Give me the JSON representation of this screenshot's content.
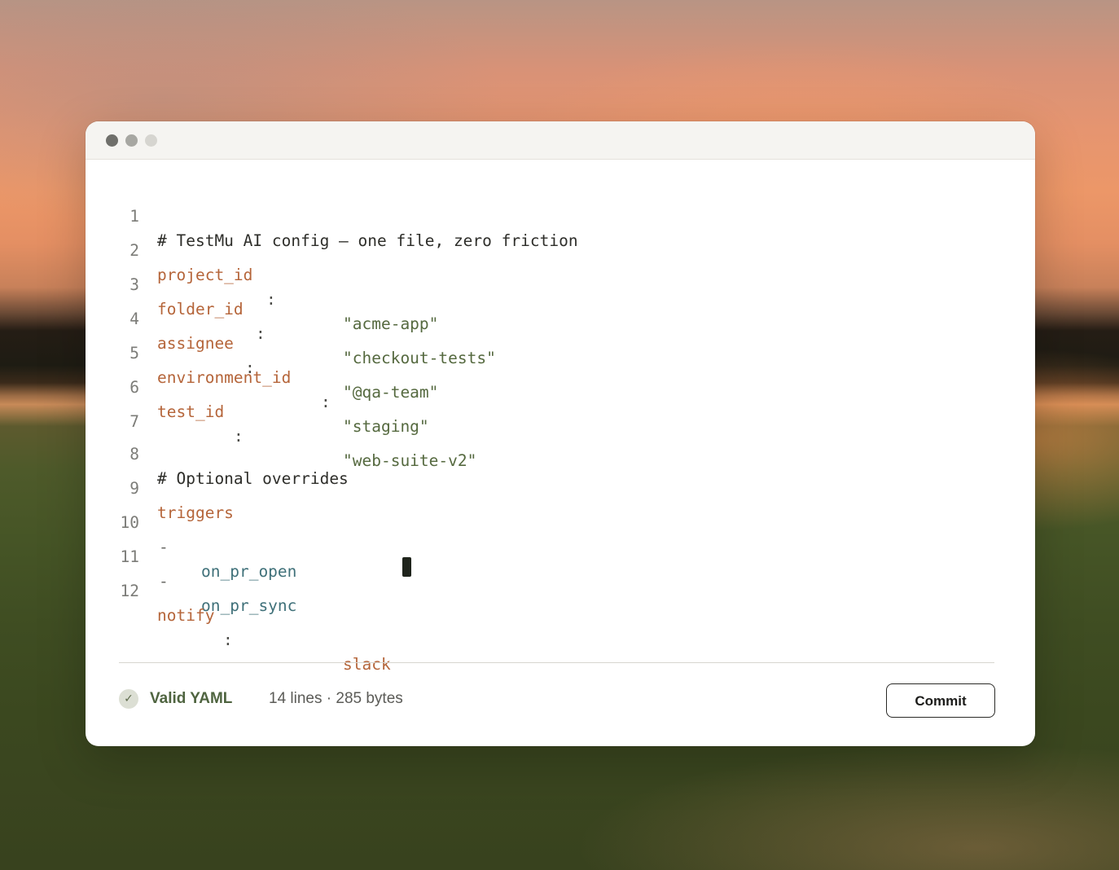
{
  "editor": {
    "lines": [
      {
        "num": "1",
        "comment": "# TestMu AI config — one file, zero friction"
      },
      {
        "num": "2",
        "key": "project_id",
        "colon": ":",
        "value": "\"acme-app\""
      },
      {
        "num": "3",
        "key": "folder_id",
        "colon": ":",
        "value": "\"checkout-tests\""
      },
      {
        "num": "4",
        "key": "assignee",
        "colon": ":",
        "value": "\"@qa-team\""
      },
      {
        "num": "5",
        "key": "environment_id",
        "colon": ":",
        "value": "\"staging\""
      },
      {
        "num": "6",
        "key": "test_id",
        "colon": ":",
        "value": "\"web-suite-v2\""
      },
      {
        "num": "7"
      },
      {
        "num": "8",
        "comment": "# Optional overrides"
      },
      {
        "num": "9",
        "key": "triggers"
      },
      {
        "num": "10",
        "dash": "-",
        "item": "on_pr_open"
      },
      {
        "num": "11",
        "dash": "-",
        "item": "on_pr_sync"
      },
      {
        "num": "12",
        "key": "notify",
        "colon": ":",
        "value": "slack"
      }
    ]
  },
  "status": {
    "valid_label": "Valid YAML",
    "stats": "14 lines · 285 bytes",
    "check_glyph": "✓"
  },
  "actions": {
    "commit_label": "Commit"
  },
  "colors": {
    "key": "#b5653a",
    "string": "#55693f",
    "list_item": "#3f7079",
    "valid": "#4f6440"
  }
}
